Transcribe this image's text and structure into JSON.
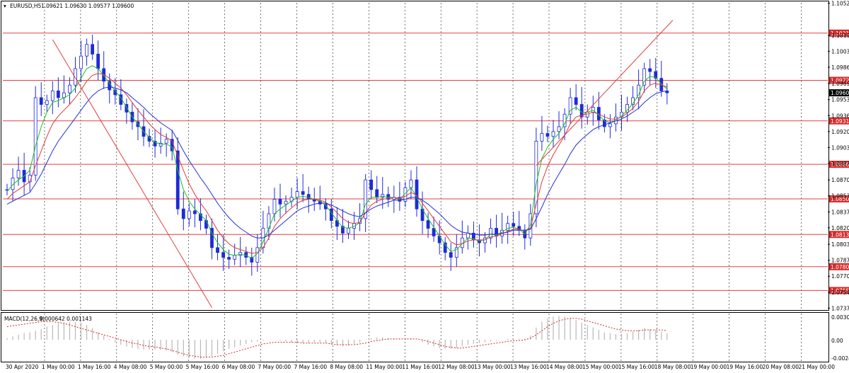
{
  "header": {
    "symbol": "EURUSD,H5",
    "ohlc": "1.09621 1.09630 1.09577 1.09600"
  },
  "macd": {
    "label": "MACD(12,26,9)",
    "values": "0.000642 0.001143",
    "scale_top": "0.003016",
    "scale_zero": "0.00",
    "scale_bottom": "-0.00249"
  },
  "colors": {
    "candles": "#1e2bd8",
    "sma_fast": "#1dbf1d",
    "sma_mid": "#e03a3a",
    "sma_slow": "#2233d6",
    "hlines": "#e04040",
    "trendlines": "#e04040",
    "price_tag": "#d42c2c",
    "current_price_tag": "#000000",
    "macd_hist": "#b8b8b8",
    "macd_signal": "#d42c2c"
  },
  "chart_data": {
    "type": "line",
    "chart_kind": "candlestick price chart with moving averages and MACD sub-window",
    "instrument": "EURUSD",
    "timeframe": "H5",
    "x_labels": [
      "30 Apr 2020",
      "1 May 00:00",
      "1 May 16:00",
      "4 May 08:00",
      "5 May 00:00",
      "5 May 16:00",
      "6 May 08:00",
      "7 May 00:00",
      "7 May 16:00",
      "8 May 08:00",
      "11 May 00:00",
      "11 May 16:00",
      "12 May 08:00",
      "13 May 00:00",
      "13 May 16:00",
      "14 May 08:00",
      "15 May 00:00",
      "15 May 16:00",
      "18 May 08:00",
      "19 May 00:00",
      "19 May 16:00",
      "20 May 08:00",
      "21 May 00:00"
    ],
    "y_ticks": [
      "1.10525",
      "1.10195",
      "1.10030",
      "1.09865",
      "1.09695",
      "1.09530",
      "1.09365",
      "1.09200",
      "1.09035",
      "1.08870",
      "1.08700",
      "1.08535",
      "1.08370",
      "1.08205",
      "1.08035",
      "1.07870",
      "1.07705",
      "1.07540",
      "1.07375"
    ],
    "ylim": [
      1.0737,
      1.1053
    ],
    "series": [
      {
        "values": [
          1.086,
          1.0872,
          1.088,
          1.0868,
          1.0875,
          1.0955,
          1.0948,
          1.0952,
          1.0962,
          1.0955,
          1.096,
          1.0968,
          1.0985,
          1.0998,
          1.101,
          1.1,
          1.0985,
          1.0972,
          1.0963,
          1.0958,
          1.0948,
          1.094,
          1.093,
          1.0925,
          1.0915,
          1.091,
          1.0905,
          1.0908,
          1.0912,
          1.09,
          1.084,
          1.083,
          1.0838,
          1.0835,
          1.0828,
          1.082,
          1.08,
          1.0795,
          1.079,
          1.0788,
          1.0792,
          1.0795,
          1.079,
          1.0785,
          1.08,
          1.082,
          1.0835,
          1.085,
          1.0845,
          1.0848,
          1.0852,
          1.0858,
          1.0855,
          1.085,
          1.0848,
          1.0845,
          1.084,
          1.0828,
          1.0822,
          1.0815,
          1.082,
          1.0825,
          1.083,
          1.087,
          1.086,
          1.0852,
          1.0855,
          1.085,
          1.0852,
          1.0848,
          1.0862,
          1.087,
          1.084,
          1.0828,
          1.082,
          1.0812,
          1.0805,
          1.0795,
          1.079,
          1.08,
          1.081,
          1.0815,
          1.0808,
          1.0805,
          1.081,
          1.082,
          1.0812,
          1.0818,
          1.0825,
          1.0822,
          1.0818,
          1.081,
          1.0835,
          1.091,
          1.0918,
          1.0915,
          1.092,
          1.0925,
          1.0938,
          1.0955,
          1.0948,
          1.0935,
          1.094,
          1.0945,
          1.0932,
          1.0925,
          1.0928,
          1.0935,
          1.094,
          1.0948,
          1.0955,
          1.0968,
          1.0985,
          1.0982,
          1.0975,
          1.0962,
          1.096
        ]
      },
      {
        "values": [
          1.0858,
          1.0865,
          1.087,
          1.0874,
          1.088,
          1.0905,
          1.0925,
          1.094,
          1.095,
          1.0952,
          1.0955,
          1.0958,
          1.0965,
          1.0975,
          1.0985,
          1.0988,
          1.0985,
          1.0978,
          1.097,
          1.0962,
          1.0955,
          1.0945,
          1.0935,
          1.0928,
          1.092,
          1.0914,
          1.0909,
          1.0907,
          1.0907,
          1.0904,
          1.088,
          1.086,
          1.0848,
          1.084,
          1.0834,
          1.0828,
          1.0815,
          1.0805,
          1.0798,
          1.0793,
          1.0792,
          1.0793,
          1.0792,
          1.0789,
          1.0794,
          1.0806,
          1.082,
          1.0835,
          1.084,
          1.0844,
          1.0848,
          1.0852,
          1.0853,
          1.0852,
          1.085,
          1.0848,
          1.0844,
          1.0836,
          1.0828,
          1.0821,
          1.082,
          1.0822,
          1.0826,
          1.0845,
          1.0852,
          1.0852,
          1.0853,
          1.0852,
          1.0852,
          1.085,
          1.0856,
          1.0862,
          1.0852,
          1.084,
          1.083,
          1.0821,
          1.0812,
          1.0803,
          1.0796,
          1.0798,
          1.0804,
          1.081,
          1.0809,
          1.0807,
          1.0808,
          1.0814,
          1.0813,
          1.0816,
          1.082,
          1.0821,
          1.0819,
          1.0814,
          1.0824,
          1.0866,
          1.0892,
          1.0904,
          1.0912,
          1.0918,
          1.0928,
          1.0942,
          1.0945,
          1.094,
          1.094,
          1.0942,
          1.0937,
          1.0931,
          1.0929,
          1.0932,
          1.0936,
          1.0942,
          1.0949,
          1.0958,
          1.0972,
          1.0977,
          1.0976,
          1.0969,
          1.0964
        ]
      },
      {
        "values": [
          1.085,
          1.0856,
          1.086,
          1.0864,
          1.0868,
          1.0885,
          1.09,
          1.0915,
          1.0928,
          1.0936,
          1.0942,
          1.0948,
          1.0955,
          1.0963,
          1.0972,
          1.0978,
          1.098,
          1.0979,
          1.0975,
          1.097,
          1.0965,
          1.0958,
          1.095,
          1.0942,
          1.0935,
          1.0928,
          1.0922,
          1.0917,
          1.0914,
          1.091,
          1.0895,
          1.088,
          1.0866,
          1.0855,
          1.0846,
          1.0838,
          1.0828,
          1.0818,
          1.081,
          1.0804,
          1.08,
          1.0798,
          1.0796,
          1.0794,
          1.0795,
          1.08,
          1.081,
          1.0822,
          1.083,
          1.0836,
          1.0841,
          1.0846,
          1.0849,
          1.085,
          1.085,
          1.0849,
          1.0847,
          1.0842,
          1.0836,
          1.083,
          1.0826,
          1.0825,
          1.0826,
          1.0836,
          1.0844,
          1.0848,
          1.085,
          1.0851,
          1.0852,
          1.0851,
          1.0853,
          1.0857,
          1.0854,
          1.0846,
          1.0838,
          1.083,
          1.0822,
          1.0814,
          1.0806,
          1.0803,
          1.0804,
          1.0807,
          1.0808,
          1.0808,
          1.0808,
          1.0811,
          1.0812,
          1.0814,
          1.0817,
          1.0819,
          1.0819,
          1.0817,
          1.082,
          1.0845,
          1.0868,
          1.0884,
          1.0896,
          1.0906,
          1.0916,
          1.0928,
          1.0935,
          1.0937,
          1.0938,
          1.094,
          1.0938,
          1.0935,
          1.0933,
          1.0933,
          1.0935,
          1.0939,
          1.0944,
          1.0951,
          1.0962,
          1.0968,
          1.097,
          1.0968,
          1.0966
        ]
      },
      {
        "values": [
          1.0845,
          1.0848,
          1.0851,
          1.0854,
          1.0857,
          1.0866,
          1.0876,
          1.0888,
          1.09,
          1.091,
          1.0918,
          1.0926,
          1.0934,
          1.0942,
          1.095,
          1.0957,
          1.0962,
          1.0965,
          1.0966,
          1.0965,
          1.0963,
          1.096,
          1.0955,
          1.095,
          1.0945,
          1.0939,
          1.0934,
          1.0929,
          1.0925,
          1.0921,
          1.0911,
          1.09,
          1.089,
          1.0881,
          1.0872,
          1.0864,
          1.0855,
          1.0846,
          1.0838,
          1.0831,
          1.0825,
          1.082,
          1.0816,
          1.0812,
          1.081,
          1.081,
          1.0813,
          1.0818,
          1.0823,
          1.0828,
          1.0833,
          1.0838,
          1.0841,
          1.0843,
          1.0845,
          1.0846,
          1.0846,
          1.0844,
          1.0841,
          1.0838,
          1.0835,
          1.0833,
          1.0832,
          1.0836,
          1.084,
          1.0843,
          1.0845,
          1.0847,
          1.0849,
          1.0849,
          1.085,
          1.0852,
          1.0852,
          1.0849,
          1.0845,
          1.084,
          1.0835,
          1.0829,
          1.0823,
          1.0819,
          1.0816,
          1.0815,
          1.0814,
          1.0813,
          1.0813,
          1.0814,
          1.0814,
          1.0815,
          1.0816,
          1.0818,
          1.0818,
          1.0818,
          1.0819,
          1.083,
          1.0842,
          1.0855,
          1.0866,
          1.0876,
          1.0886,
          1.0897,
          1.0906,
          1.0912,
          1.0917,
          1.0922,
          1.0925,
          1.0927,
          1.0929,
          1.0931,
          1.0933,
          1.0936,
          1.094,
          1.0944,
          1.095,
          1.0955,
          1.0959,
          1.0961,
          1.0962
        ]
      }
    ],
    "horizontal_levels": [
      {
        "value": 1.10217,
        "label": "1.10217"
      },
      {
        "value": 1.09729,
        "label": "1.09729"
      },
      {
        "value": 1.0931,
        "label": "1.09310"
      },
      {
        "value": 1.08861,
        "label": "1.08861"
      },
      {
        "value": 1.08504,
        "label": "1.08504"
      },
      {
        "value": 1.08136,
        "label": "1.08136"
      },
      {
        "value": 1.07803,
        "label": "1.07803"
      },
      {
        "value": 1.07557,
        "label": "1.07557"
      }
    ],
    "current_price": {
      "value": 1.096,
      "label": "1.09600"
    },
    "trend_lines": [
      {
        "from": [
          8,
          1.1015
        ],
        "to": [
          36,
          1.0738
        ]
      },
      {
        "from": [
          93,
          1.0885
        ],
        "to": [
          117,
          1.1035
        ]
      }
    ],
    "macd_hist": [
      0.0002,
      0.0004,
      0.0006,
      0.0008,
      0.0009,
      0.0011,
      0.0013,
      0.0016,
      0.0018,
      0.002,
      0.0021,
      0.0022,
      0.0022,
      0.0021,
      0.0018,
      0.0014,
      0.0009,
      0.0005,
      0.0001,
      -0.0003,
      -0.0006,
      -0.0008,
      -0.001,
      -0.0011,
      -0.0012,
      -0.0012,
      -0.0012,
      -0.0012,
      -0.0013,
      -0.0015,
      -0.0018,
      -0.002,
      -0.0022,
      -0.0023,
      -0.0023,
      -0.0022,
      -0.002,
      -0.0017,
      -0.0014,
      -0.0011,
      -0.0009,
      -0.0007,
      -0.0005,
      -0.0003,
      -0.0002,
      -0.0001,
      0.0,
      0.0,
      -0.0001,
      -0.0002,
      -0.0003,
      -0.0004,
      -0.0004,
      -0.0004,
      -0.0003,
      -0.0003,
      -0.0004,
      -0.0006,
      -0.0007,
      -0.0008,
      -0.0007,
      -0.0005,
      -0.0003,
      0.0,
      0.0002,
      0.0003,
      0.0003,
      0.0002,
      0.0001,
      0.0001,
      0.0002,
      0.0002,
      0.0,
      -0.0003,
      -0.0006,
      -0.0008,
      -0.001,
      -0.0011,
      -0.0011,
      -0.001,
      -0.0008,
      -0.0006,
      -0.0005,
      -0.0004,
      -0.0003,
      -0.0002,
      -0.0001,
      0.0,
      0.0001,
      0.0001,
      0.0001,
      0.0001,
      0.0005,
      0.0015,
      0.0022,
      0.0026,
      0.0028,
      0.0029,
      0.0028,
      0.0026,
      0.0024,
      0.0021,
      0.0018,
      0.0015,
      0.0012,
      0.0009,
      0.0008,
      0.0007,
      0.0007,
      0.0008,
      0.001,
      0.0012,
      0.0014,
      0.0013,
      0.0012,
      0.001,
      0.0008
    ],
    "macd_signal": [
      0.0016,
      0.0017,
      0.0018,
      0.0019,
      0.002,
      0.0021,
      0.0022,
      0.0022,
      0.0022,
      0.0021,
      0.002,
      0.0018,
      0.0016,
      0.0014,
      0.0012,
      0.001,
      0.0008,
      0.0006,
      0.0004,
      0.0002,
      0.0,
      -0.0002,
      -0.0004,
      -0.0005,
      -0.0007,
      -0.0008,
      -0.0009,
      -0.001,
      -0.0011,
      -0.0013,
      -0.0015,
      -0.0017,
      -0.0019,
      -0.002,
      -0.0021,
      -0.0021,
      -0.0021,
      -0.002,
      -0.0019,
      -0.0017,
      -0.0015,
      -0.0013,
      -0.0011,
      -0.0009,
      -0.0007,
      -0.0005,
      -0.0004,
      -0.0003,
      -0.0003,
      -0.0003,
      -0.0003,
      -0.0003,
      -0.0004,
      -0.0004,
      -0.0004,
      -0.0004,
      -0.0004,
      -0.0005,
      -0.0006,
      -0.0006,
      -0.0006,
      -0.0006,
      -0.0005,
      -0.0004,
      -0.0002,
      -0.0001,
      0.0,
      0.0001,
      0.0001,
      0.0001,
      0.0001,
      0.0001,
      0.0001,
      0.0,
      -0.0002,
      -0.0004,
      -0.0006,
      -0.0008,
      -0.0009,
      -0.001,
      -0.001,
      -0.0009,
      -0.0008,
      -0.0007,
      -0.0006,
      -0.0005,
      -0.0004,
      -0.0003,
      -0.0002,
      -0.0001,
      -0.0001,
      0.0,
      0.0002,
      0.0006,
      0.0011,
      0.0016,
      0.002,
      0.0023,
      0.0025,
      0.0026,
      0.0026,
      0.0025,
      0.0023,
      0.0021,
      0.0019,
      0.0017,
      0.0015,
      0.0013,
      0.0012,
      0.0011,
      0.0011,
      0.0011,
      0.0012,
      0.0012,
      0.0012,
      0.0012,
      0.0011
    ]
  }
}
